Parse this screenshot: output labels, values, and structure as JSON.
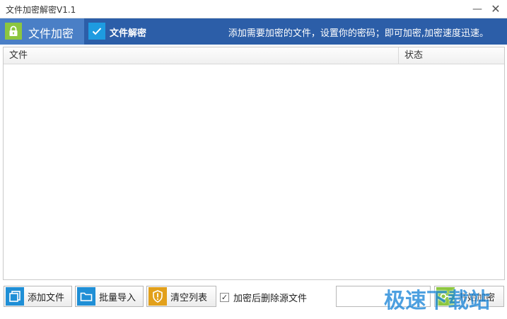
{
  "window": {
    "title": "文件加密解密V1.1",
    "minimize": "—",
    "close": "✕"
  },
  "tabs": [
    {
      "label": "文件加密",
      "icon": "lock-icon",
      "active": true
    },
    {
      "label": "文件解密",
      "icon": "check-icon",
      "active": false
    }
  ],
  "hint": "添加需要加密的文件，设置你的密码；即可加密,加密速度迅速。",
  "table": {
    "columns": [
      "文件",
      "状态"
    ],
    "rows": []
  },
  "toolbar": {
    "add_files": "添加文件",
    "batch_import": "批量导入",
    "clear_list": "清空列表",
    "delete_source": {
      "label": "加密后删除源文件",
      "checked": true
    },
    "password_value": "",
    "start_encrypt": "开始加密"
  },
  "watermark": "极速下载站",
  "colors": {
    "tabbar": "#2c5ea8",
    "active_tab": "#4a7fc6",
    "lock_green": "#8cc63f",
    "check_blue": "#1e9be0",
    "folder_blue": "#1f8fd6",
    "warning_orange": "#e2a01b"
  }
}
